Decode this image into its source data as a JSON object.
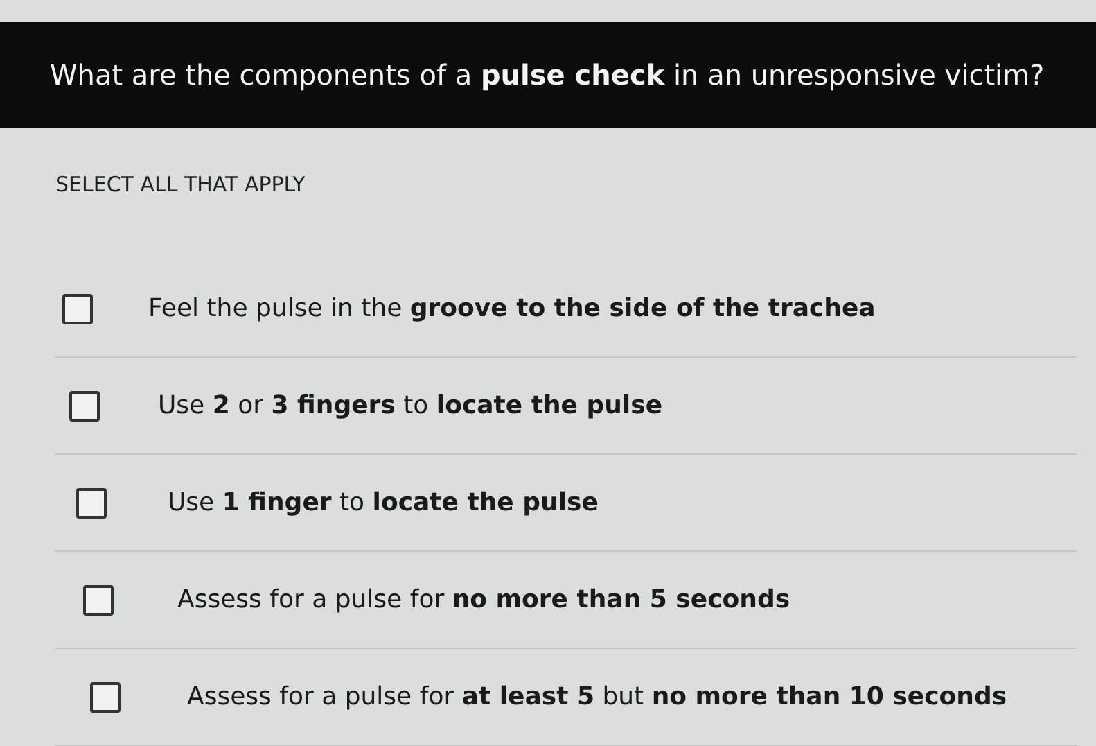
{
  "question": "What are the components of a **pulse check** in an unresponsive victim?",
  "instruction": "SELECT ALL THAT APPLY",
  "options": [
    {
      "text": "Feel the pulse in the **groove to the side of the trachea**",
      "checked": false
    },
    {
      "text": "Use **2** or **3 fingers** to **locate the pulse**",
      "checked": false
    },
    {
      "text": "Use **1 finger** to **locate the pulse**",
      "checked": false
    },
    {
      "text": "Assess for a pulse for **no more than 5 seconds**",
      "checked": false
    },
    {
      "text": "Assess for a pulse for **at least 5** but **no more than 10 seconds**",
      "checked": false
    }
  ]
}
